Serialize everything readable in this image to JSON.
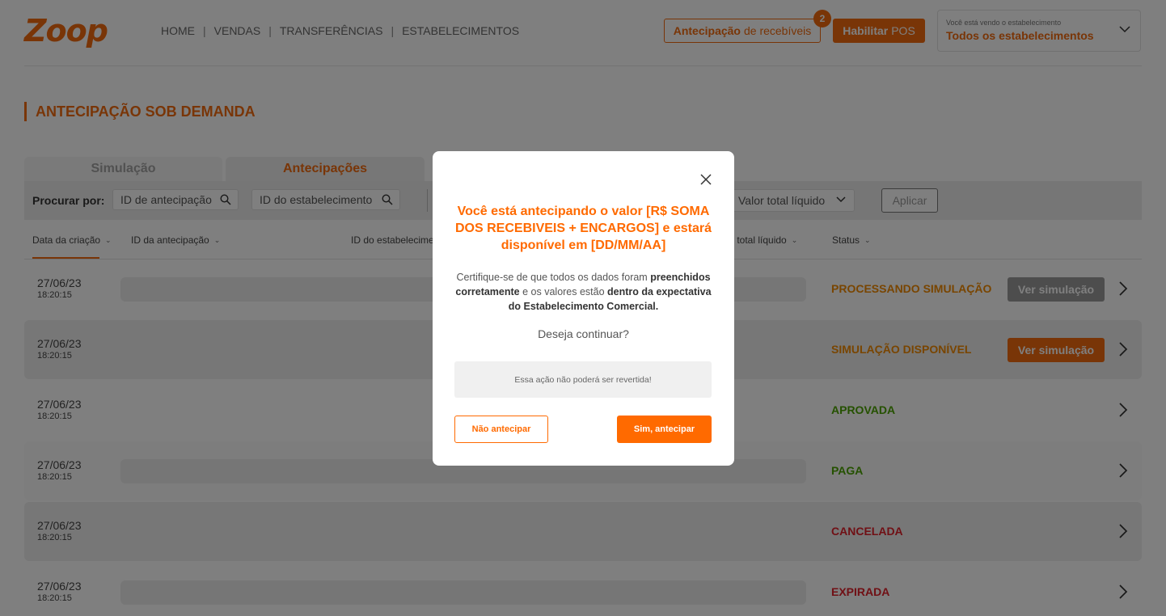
{
  "colors": {
    "brand": "#f26b0f",
    "modal_accent": "#ff6a00",
    "status_orange": "#f28a00",
    "status_green": "#4aa300",
    "status_red": "#e0202a",
    "btn_gray": "#9a9a9a"
  },
  "header": {
    "logo": "Zoop",
    "nav": [
      "HOME",
      "VENDAS",
      "TRANSFERÊNCIAS",
      "ESTABELECIMENTOS"
    ],
    "nav_separator": "|",
    "antecipacao_bold": "Antecipação",
    "antecipacao_rest": "de recebíveis",
    "antecipacao_badge": "2",
    "pos_bold": "Habilitar",
    "pos_rest": "POS",
    "estab_caption": "Você está vendo o estabelecimento",
    "estab_value": "Todos os estabelecimentos"
  },
  "page": {
    "title": "ANTECIPAÇÃO SOB DEMANDA"
  },
  "tabs": [
    {
      "label": "Simulação",
      "active": false
    },
    {
      "label": "Antecipações",
      "active": true
    }
  ],
  "filters": {
    "label": "Procurar por:",
    "search_antecipacao": "ID de antecipação",
    "search_estabelecimento": "ID do estabelecimento",
    "total_select": "Valor total líquido",
    "apply": "Aplicar"
  },
  "table": {
    "headers": {
      "created": "Data da criação",
      "antecipacao_id": "ID da antecipação",
      "estab_id": "ID do estabelecime",
      "total": "r total líquido",
      "status": "Status"
    },
    "rows": [
      {
        "date": "27/06/23",
        "time": "18:20:15",
        "status": "PROCESSANDO SIMULAÇÃO",
        "status_color": "#f28a00",
        "action": "Ver simulação",
        "action_enabled": false
      },
      {
        "date": "27/06/23",
        "time": "18:20:15",
        "status": "SIMULAÇÃO DISPONÍVEL",
        "status_color": "#f28a00",
        "action": "Ver simulação",
        "action_enabled": true
      },
      {
        "date": "27/06/23",
        "time": "18:20:15",
        "status": "APROVADA",
        "status_color": "#4aa300",
        "action": "",
        "action_enabled": false
      },
      {
        "date": "27/06/23",
        "time": "18:20:15",
        "status": "PAGA",
        "status_color": "#4aa300",
        "action": "",
        "action_enabled": false
      },
      {
        "date": "27/06/23",
        "time": "18:20:15",
        "status": "CANCELADA",
        "status_color": "#e0202a",
        "action": "",
        "action_enabled": false
      },
      {
        "date": "27/06/23",
        "time": "18:20:15",
        "status": "EXPIRADA",
        "status_color": "#e0202a",
        "action": "",
        "action_enabled": false
      }
    ]
  },
  "modal": {
    "title": "Você está antecipando o valor [R$ SOMA DOS RECEBIVEIS + ENCARGOS] e estará disponível em [DD/MM/AA]",
    "body_1": "Certifique-se de que todos os dados foram",
    "body_2_bold": "preenchidos corretamente",
    "body_3": "e os valores estão",
    "body_4_bold": "dentro da expectativa do Estabelecimento Comercial.",
    "question": "Deseja continuar?",
    "warning": "Essa ação não poderá ser revertida!",
    "cancel": "Não antecipar",
    "confirm": "Sim, antecipar"
  }
}
